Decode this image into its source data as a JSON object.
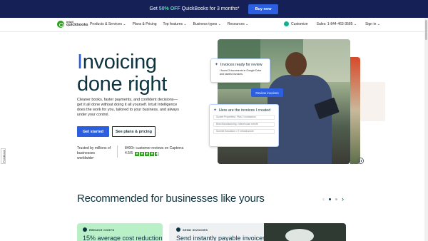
{
  "promo": {
    "prefix": "Get ",
    "highlight": "50% OFF",
    "suffix": " QuickBooks for 3 months*",
    "button": "Buy now"
  },
  "nav": {
    "logo_top": "intuit",
    "logo_bottom": "quickbooks",
    "links": [
      "Products & Services ⌄",
      "Plans & Pricing",
      "Top features ⌄",
      "Business types ⌄",
      "Resources ⌄"
    ],
    "customize": "Customize",
    "sales": "Sales: 1-844-463-3585 ⌄",
    "signin": "Sign in ⌄"
  },
  "hero": {
    "headline_first": "I",
    "headline_rest": "nvoicing",
    "headline_line2": "done right",
    "description": "Cleaner books, faster payments, and confident decisions—get it all done without doing it all yourself. Intuit Intelligence does the work for you, tailored to your business, and always under your control.",
    "cta_primary": "Get started",
    "cta_secondary": "See plans & pricing",
    "trust_text": "Trusted by millions of businesses worldwide¹",
    "reviews_text": "8400+ customer reviews on Capterra",
    "rating": "4.5/5",
    "stars": 4.5
  },
  "cards": {
    "card1_title": "Invoices ready for review",
    "card1_body": "I found 3 documents in Google Drive and started invoices.",
    "review_button": "Review invoices",
    "card2_title": "Here are the invoices I created",
    "invoice_rows": [
      "Sunset Properties • Plan 2 contractors",
      "Bela Manufacturing • Warehouse retrofit",
      "Summit Education • IT infrastructure"
    ]
  },
  "feedback": "Feedback",
  "recommended": {
    "title": "Recommended for businesses like yours",
    "card1_label": "REDUCE COSTS",
    "card1_heading": "15% average cost reduction",
    "card2_label": "SEND INVOICES",
    "card2_heading": "Send instantly payable invoices"
  },
  "colors": {
    "promo_bg": "#152057",
    "accent_blue": "#2b5fe0",
    "brand_green": "#2ca01c",
    "highlight_green": "#4ee0a8"
  }
}
